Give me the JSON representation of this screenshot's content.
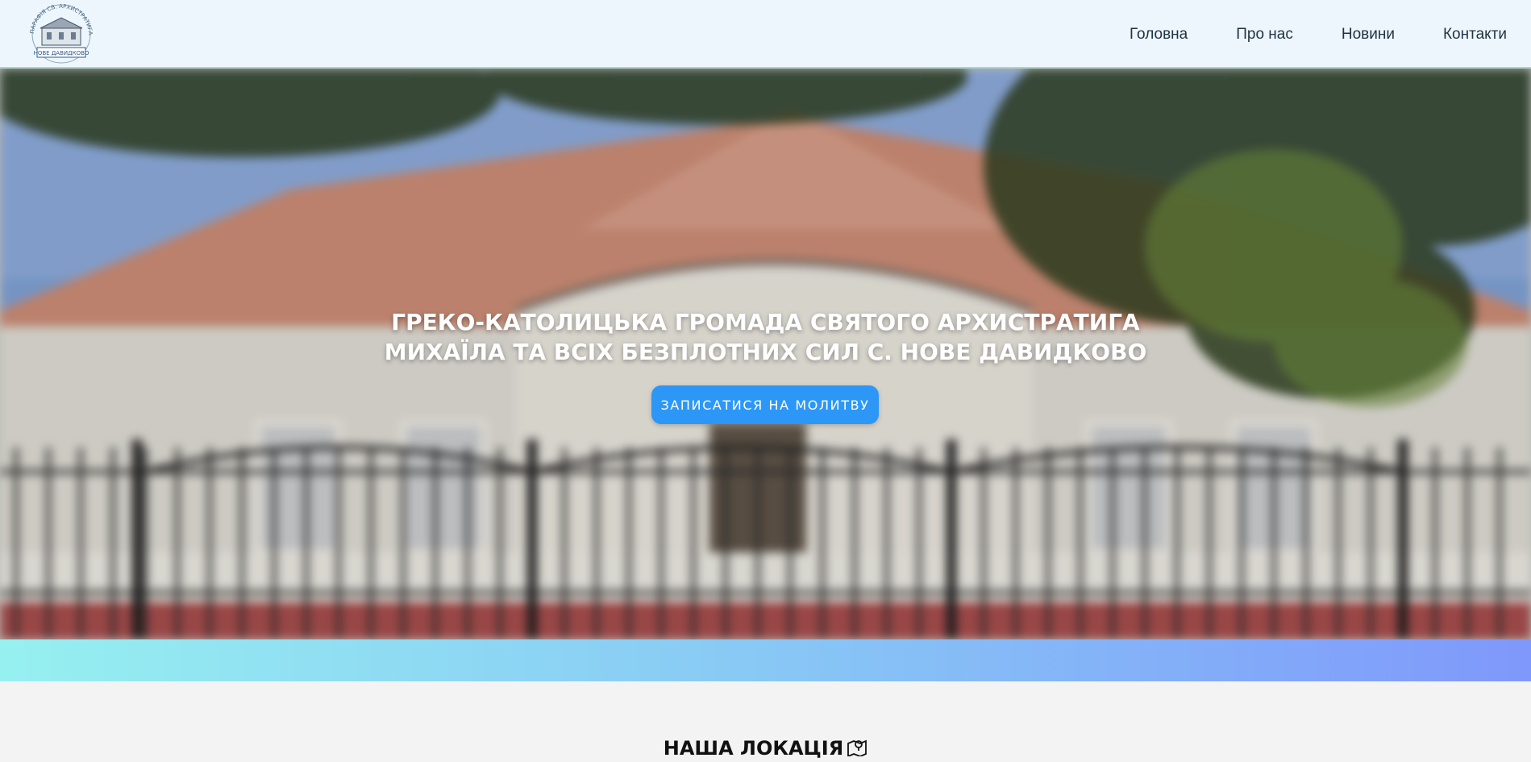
{
  "header": {
    "logo_alt": "Парафія св. Архистратига Михаїла Нове Давидково",
    "logo_text_top": "ПАРАФІЯ СВ. АРХИСТРАТИГА МИХАЇЛА",
    "logo_text_bottom": "НОВЕ ДАВИДКОВО",
    "nav": [
      {
        "label": "Головна"
      },
      {
        "label": "Про нас"
      },
      {
        "label": "Новини"
      },
      {
        "label": "Контакти"
      }
    ]
  },
  "hero": {
    "title_line1": "ГРЕКО-КАТОЛИЦЬКА ГРОМАДА СВЯТОГО АРХИСТРАТИГА",
    "title_line2": "МИХАЇЛА ТА ВСІХ БЕЗПЛОТНИХ СИЛ С. НОВЕ ДАВИДКОВО",
    "cta_label": "ЗАПИСАТИСЯ НА МОЛИТВУ",
    "background": "church-building-photo"
  },
  "location": {
    "title": "НАША ЛОКАЦІЯ",
    "icon": "map-pin-icon"
  },
  "colors": {
    "header_bg": "#eef6fd",
    "cta_bg": "#2d97f7",
    "band_start": "#96f0f0",
    "band_end": "#7f98fb"
  }
}
